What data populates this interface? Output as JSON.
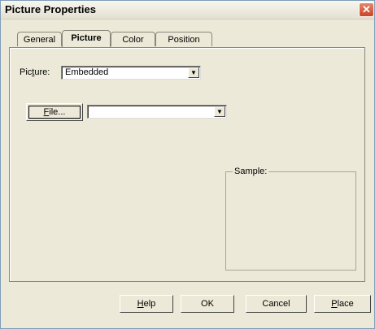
{
  "window": {
    "title": "Picture Properties",
    "close_glyph": "✕"
  },
  "tabs": [
    {
      "label": "General",
      "active": false
    },
    {
      "label": "Picture",
      "active": true
    },
    {
      "label": "Color",
      "active": false
    },
    {
      "label": "Position",
      "active": false
    }
  ],
  "picture": {
    "label_pre": "Pic",
    "label_mnemonic": "t",
    "label_post": "ure:",
    "value": "Embedded",
    "arrow_glyph": "▼"
  },
  "file": {
    "button_mnemonic": "F",
    "button_rest": "ile...",
    "path_value": "",
    "arrow_glyph": "▼"
  },
  "sample": {
    "label": "Sample:"
  },
  "buttons": {
    "help_mnemonic": "H",
    "help_rest": "elp",
    "ok_label": "OK",
    "cancel_label": "Cancel",
    "place_mnemonic": "P",
    "place_rest": "lace"
  }
}
